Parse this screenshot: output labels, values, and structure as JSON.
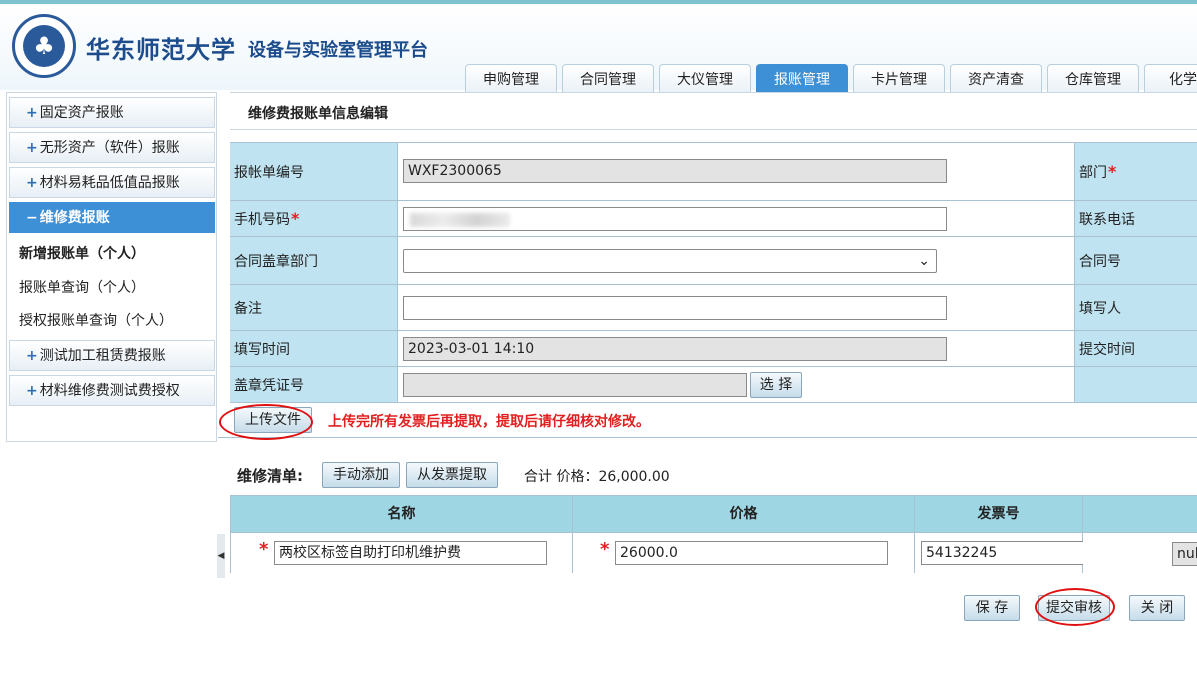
{
  "header": {
    "university": "华东师范大学",
    "platform": "设备与实验室管理平台",
    "tabs": [
      {
        "label": "申购管理",
        "active": false
      },
      {
        "label": "合同管理",
        "active": false
      },
      {
        "label": "大仪管理",
        "active": false
      },
      {
        "label": "报账管理",
        "active": true
      },
      {
        "label": "卡片管理",
        "active": false
      },
      {
        "label": "资产清查",
        "active": false
      },
      {
        "label": "仓库管理",
        "active": false
      },
      {
        "label": "化学品",
        "active": false
      }
    ]
  },
  "sidebar": {
    "items": [
      {
        "label": "固定资产报账",
        "prefix": "+"
      },
      {
        "label": "无形资产（软件）报账",
        "prefix": "+"
      },
      {
        "label": "材料易耗品低值品报账",
        "prefix": "+"
      },
      {
        "label": "维修费报账",
        "prefix": "−"
      },
      {
        "label": "测试加工租赁费报账",
        "prefix": "+"
      },
      {
        "label": "材料维修费测试费授权",
        "prefix": "+"
      }
    ],
    "subitems": [
      {
        "label": "新增报账单（个人）"
      },
      {
        "label": "报账单查询（个人）"
      },
      {
        "label": "授权报账单查询（个人）"
      }
    ]
  },
  "main": {
    "title": "维修费报账单信息编辑",
    "form": {
      "bill_no_label": "报帐单编号",
      "bill_no_value": "WXF2300065",
      "dept_label": "部门",
      "phone_label": "手机号码",
      "contact_phone_label": "联系电话",
      "seal_dept_label": "合同盖章部门",
      "contract_no_label": "合同号",
      "remark_label": "备注",
      "filler_label": "填写人",
      "fill_time_label": "填写时间",
      "fill_time_value": "2023-03-01 14:10",
      "submit_time_label": "提交时间",
      "seal_voucher_label": "盖章凭证号",
      "select_button": "选 择",
      "required_mark": "*"
    },
    "upload": {
      "button": "上传文件",
      "note": "上传完所有发票后再提取，提取后请仔细核对修改。"
    },
    "repair_list": {
      "label": "维修清单:",
      "manual_add": "手动添加",
      "extract_invoice": "从发票提取",
      "total_text": "合计  价格：26,000.00",
      "headers": [
        "名称",
        "价格",
        "发票号"
      ],
      "rows": [
        {
          "name": "两校区标签自助打印机维护费",
          "price": "26000.0",
          "invoice": "54132245",
          "extra": "null"
        }
      ]
    },
    "actions": {
      "save": "保 存",
      "submit": "提交审核",
      "close": "关 闭"
    }
  },
  "colors": {
    "accent": "#3d8fd6",
    "label_bg": "#bfe3f1",
    "header_bg": "#9fd6e4",
    "warning": "#e02020"
  }
}
